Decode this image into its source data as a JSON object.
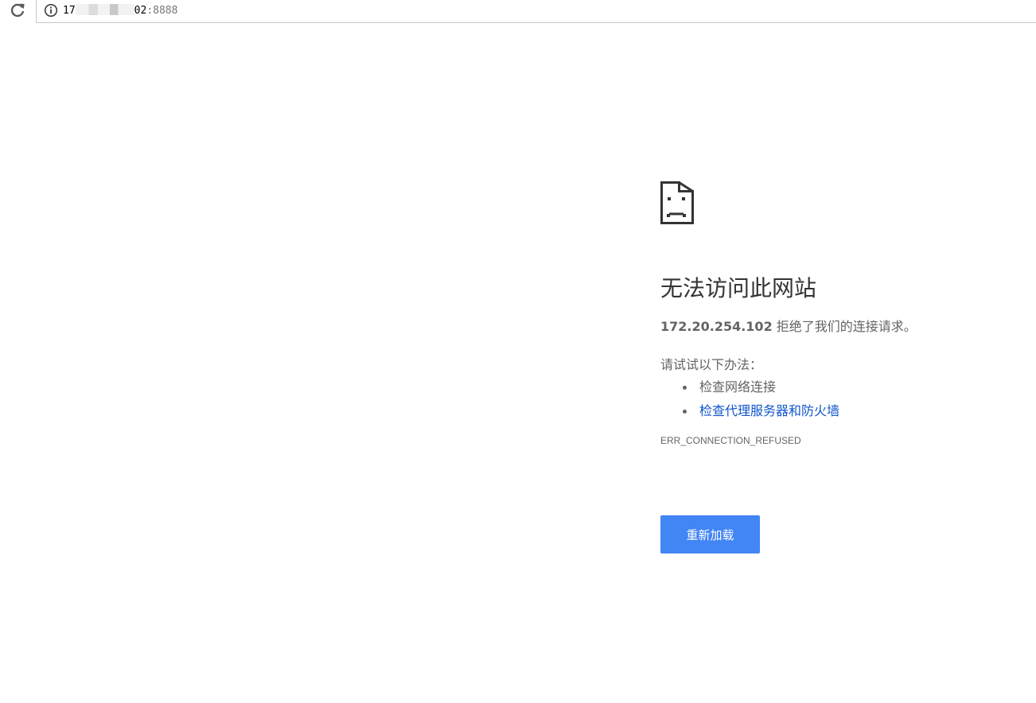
{
  "browser": {
    "reload_icon": "reload-icon",
    "info_icon": "info-icon",
    "address": {
      "host_visible_prefix": "17",
      "host_visible_suffix": "02",
      "port": ":8888"
    }
  },
  "error_page": {
    "icon": "sad-page-icon",
    "heading": "无法访问此网站",
    "summary_host": "172.20.254.102",
    "summary_text": " 拒绝了我们的连接请求。",
    "suggestions_intro": "请试试以下办法：",
    "suggestions": [
      {
        "label": "检查网络连接",
        "is_link": false
      },
      {
        "label": "检查代理服务器和防火墙",
        "is_link": true
      }
    ],
    "error_code": "ERR_CONNECTION_REFUSED",
    "reload_button_label": "重新加载"
  },
  "colors": {
    "button": "#4285f4",
    "link": "#1155cc",
    "text": "#646464",
    "heading": "#333333"
  }
}
